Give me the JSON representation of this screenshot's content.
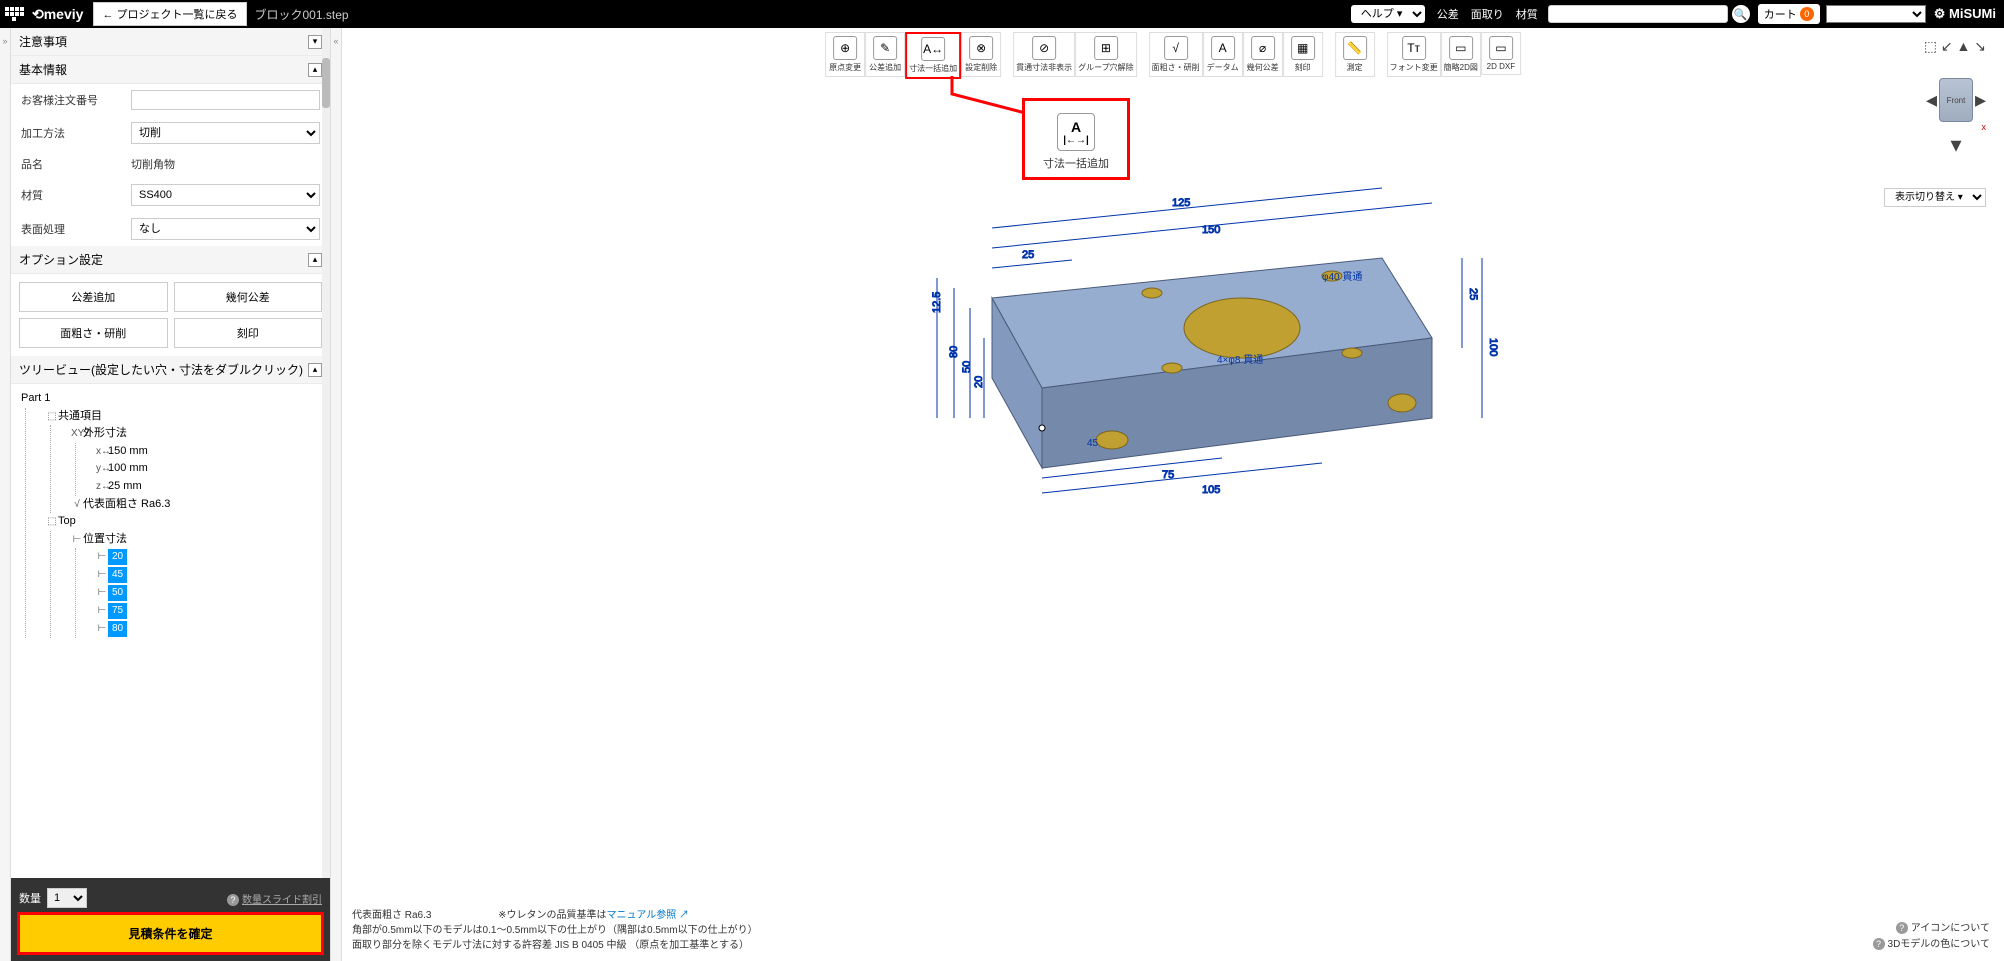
{
  "topbar": {
    "logo": "meviy",
    "back": "← プロジェクト一覧に戻る",
    "filename": "ブロック001.step",
    "help": "ヘルプ ▾",
    "links": [
      "公差",
      "面取り",
      "材質"
    ],
    "cart_label": "カート",
    "cart_count": "0",
    "misumi": "MiSUMi"
  },
  "sidebar": {
    "sections": {
      "notes": "注意事項",
      "basic": "基本情報",
      "options": "オプション設定",
      "tree": "ツリービュー(設定したい穴・寸法をダブルクリック)"
    },
    "basic": {
      "order_no_label": "お客様注文番号",
      "method_label": "加工方法",
      "method_value": "切削",
      "name_label": "品名",
      "name_value": "切削角物",
      "material_label": "材質",
      "material_value": "SS400",
      "surface_label": "表面処理",
      "surface_value": "なし"
    },
    "opt_buttons": [
      "公差追加",
      "幾何公差",
      "面粗さ・研削",
      "刻印"
    ],
    "tree": {
      "root": "Part 1",
      "common": "共通項目",
      "gaikei": "外形寸法",
      "dims": [
        "150 mm",
        "100 mm",
        "25 mm"
      ],
      "roughness": "代表面粗さ Ra6.3",
      "top": "Top",
      "posdim": "位置寸法",
      "posvals": [
        "20",
        "45",
        "50",
        "75",
        "80"
      ]
    },
    "qty_label": "数量",
    "qty_value": "1",
    "slide_link": "数量スライド割引",
    "confirm": "見積条件を確定"
  },
  "toolbar": {
    "items": [
      {
        "label": "原点変更",
        "icon": "⊕"
      },
      {
        "label": "公差追加",
        "icon": "✎"
      },
      {
        "label": "寸法一括追加",
        "icon": "A↔",
        "highlight": true
      },
      {
        "label": "設定削除",
        "icon": "⊗"
      },
      {
        "label": "貫通寸法非表示",
        "icon": "⊘"
      },
      {
        "label": "グループ穴解除",
        "icon": "⊞"
      },
      {
        "label": "面粗さ・研削",
        "icon": "√"
      },
      {
        "label": "データム",
        "icon": "A"
      },
      {
        "label": "幾何公差",
        "icon": "⌀"
      },
      {
        "label": "刻印",
        "icon": "▦"
      },
      {
        "label": "測定",
        "icon": "📏"
      },
      {
        "label": "フォント変更",
        "icon": "Tт"
      },
      {
        "label": "簡略2D図",
        "icon": "▭"
      },
      {
        "label": "2D DXF",
        "icon": "▭"
      }
    ],
    "gaps": [
      4,
      6,
      10,
      11
    ]
  },
  "callout": {
    "icon_top": "A",
    "icon_bottom": "|←→|",
    "label": "寸法一括追加"
  },
  "model": {
    "dims_top": [
      "125",
      "150",
      "25"
    ],
    "dims_left": [
      "12.5",
      "80",
      "50",
      "20"
    ],
    "dims_right": [
      "25",
      "100"
    ],
    "dims_bottom": [
      "75",
      "105"
    ],
    "hole_note": "φ40 貫通",
    "hole_note2": "4×φ8 貫通",
    "hole_note3": "45"
  },
  "view_switch": "表示切り替え ▾",
  "cube_label": "Front",
  "bottom_info": {
    "line1": "代表面粗さ Ra6.3",
    "line1b_pre": "※ウレタンの品質基準は",
    "line1b_link": "マニュアル参照 ↗",
    "line2": "角部が0.5mm以下のモデルは0.1〜0.5mm以下の仕上がり（隅部は0.5mm以下の仕上がり）",
    "line3": "面取り部分を除くモデル寸法に対する許容差 JIS B 0405 中級 （原点を加工基準とする）"
  },
  "bottom_right": {
    "l1": "アイコンについて",
    "l2": "3Dモデルの色について"
  }
}
